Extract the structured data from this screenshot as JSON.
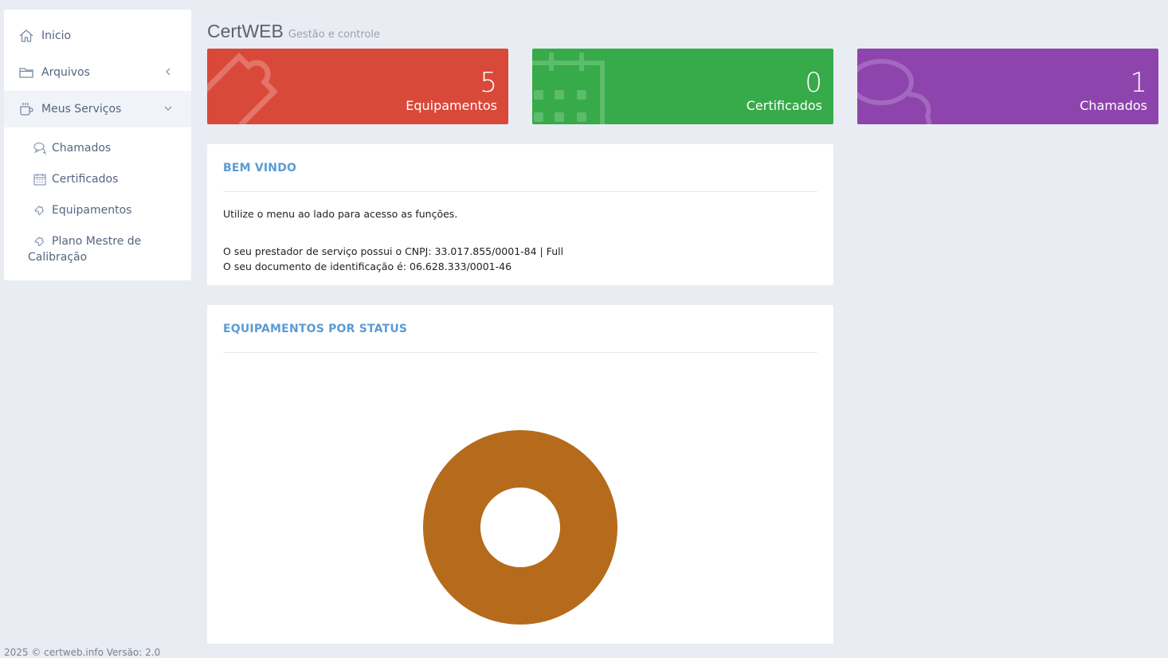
{
  "sidebar": {
    "items": [
      {
        "label": "Inicio",
        "icon": "home-icon"
      },
      {
        "label": "Arquivos",
        "icon": "folder-icon"
      },
      {
        "label": "Meus Serviços",
        "icon": "mug-icon"
      }
    ],
    "sub_items": [
      {
        "label": "Chamados",
        "icon": "chat-icon"
      },
      {
        "label": "Certificados",
        "icon": "calendar-icon"
      },
      {
        "label": "Equipamentos",
        "icon": "puzzle-icon"
      },
      {
        "label_line1": "Plano Mestre de",
        "label_line2": "Calibração",
        "icon": "puzzle-icon"
      }
    ]
  },
  "header": {
    "title": "CertWEB",
    "subtitle": "Gestão e controle"
  },
  "stats": [
    {
      "value": "5",
      "label": "Equipamentos",
      "color": "#d9493a",
      "icon": "puzzle-icon"
    },
    {
      "value": "0",
      "label": "Certificados",
      "color": "#37aa49",
      "icon": "calendar-icon"
    },
    {
      "value": "1",
      "label": "Chamados",
      "color": "#8e44ad",
      "icon": "chat-icon"
    }
  ],
  "welcome": {
    "title": "BEM VINDO",
    "line1": "Utilize o menu ao lado para acesso as funções.",
    "line2": "O seu prestador de serviço possui o CNPJ: 33.017.855/0001-84 | Full",
    "line3": "O seu documento de identificação é: 06.628.333/0001-46"
  },
  "equip_status": {
    "title": "EQUIPAMENTOS POR STATUS"
  },
  "chart_data": {
    "type": "pie",
    "variant": "doughnut",
    "series": [
      {
        "values": [
          5
        ]
      }
    ],
    "colors": [
      "#b56b1b"
    ]
  },
  "footer": {
    "text": "2025 © certweb.info Versão: 2.0"
  }
}
